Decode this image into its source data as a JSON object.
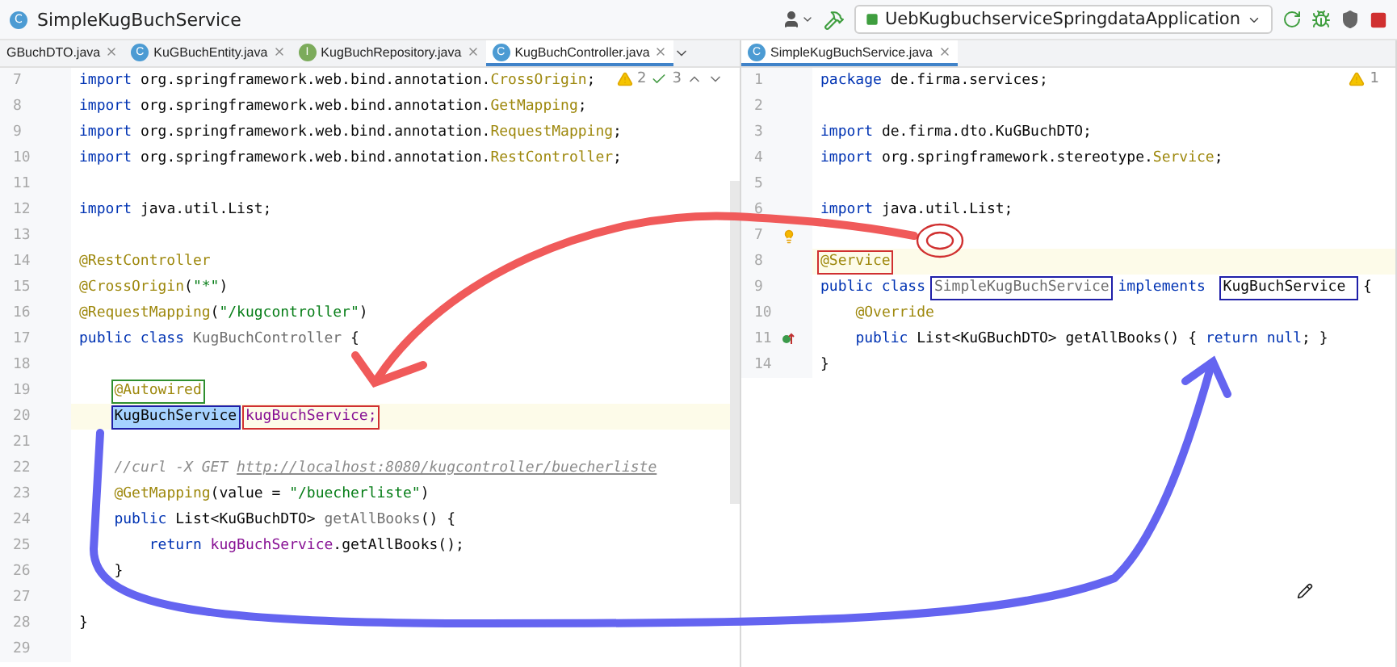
{
  "title_bar": {
    "badge": "C",
    "title": "SimpleKugBuchService",
    "run_config": "UebKugbuchserviceSpringdataApplication"
  },
  "panes": [
    {
      "tabs": [
        {
          "label": "GBuchDTO.java",
          "selected": false
        },
        {
          "label": "KuGBuchEntity.java",
          "badge": "C",
          "kind": "class",
          "selected": false
        },
        {
          "label": "KugBuchRepository.java",
          "badge": "I",
          "kind": "interface",
          "selected": false
        },
        {
          "label": "KugBuchController.java",
          "badge": "C",
          "kind": "class",
          "selected": true
        }
      ],
      "inspection": [
        {
          "kind": "warning",
          "count": "2"
        },
        {
          "kind": "check",
          "count": "3"
        }
      ],
      "lines": [
        {
          "number": "7",
          "current": false,
          "tokens": [
            {
              "kind": "kw",
              "text": "import "
            },
            {
              "kind": "plain",
              "text": "org.springframework.web.bind.annotation."
            },
            {
              "kind": "ann",
              "text": "CrossOrigin"
            },
            {
              "kind": "plain",
              "text": ";"
            }
          ]
        },
        {
          "number": "8",
          "current": false,
          "tokens": [
            {
              "kind": "kw",
              "text": "import "
            },
            {
              "kind": "plain",
              "text": "org.springframework.web.bind.annotation."
            },
            {
              "kind": "ann",
              "text": "GetMapping"
            },
            {
              "kind": "plain",
              "text": ";"
            }
          ]
        },
        {
          "number": "9",
          "current": false,
          "tokens": [
            {
              "kind": "kw",
              "text": "import "
            },
            {
              "kind": "plain",
              "text": "org.springframework.web.bind.annotation."
            },
            {
              "kind": "ann",
              "text": "RequestMapping"
            },
            {
              "kind": "plain",
              "text": ";"
            }
          ]
        },
        {
          "number": "10",
          "current": false,
          "tokens": [
            {
              "kind": "kw",
              "text": "import "
            },
            {
              "kind": "plain",
              "text": "org.springframework.web.bind.annotation."
            },
            {
              "kind": "ann",
              "text": "RestController"
            },
            {
              "kind": "plain",
              "text": ";"
            }
          ]
        },
        {
          "number": "11",
          "current": false
        },
        {
          "number": "12",
          "current": false,
          "tokens": [
            {
              "kind": "kw",
              "text": "import "
            },
            {
              "kind": "plain",
              "text": "java.util.List;"
            }
          ]
        },
        {
          "number": "13",
          "current": false
        },
        {
          "number": "14",
          "current": false,
          "tokens": [
            {
              "kind": "ann",
              "text": "@RestController"
            }
          ]
        },
        {
          "number": "15",
          "current": false,
          "tokens": [
            {
              "kind": "ann",
              "text": "@CrossOrigin"
            },
            {
              "kind": "plain",
              "text": "("
            },
            {
              "kind": "str",
              "text": "\"*\""
            },
            {
              "kind": "plain",
              "text": ")"
            }
          ]
        },
        {
          "number": "16",
          "current": false,
          "tokens": [
            {
              "kind": "ann",
              "text": "@RequestMapping"
            },
            {
              "kind": "plain",
              "text": "("
            },
            {
              "kind": "str",
              "text": "\"/kugcontroller\""
            },
            {
              "kind": "plain",
              "text": ")"
            }
          ]
        },
        {
          "number": "17",
          "current": false,
          "tokens": [
            {
              "kind": "kw",
              "text": "public class "
            },
            {
              "kind": "dim",
              "text": "KugBuchController"
            },
            {
              "kind": "plain",
              "text": " {"
            }
          ]
        },
        {
          "number": "18",
          "current": false
        },
        {
          "number": "19",
          "current": false,
          "tokens": [
            {
              "kind": "ann",
              "text": "    @Autowired",
              "color": "#2f8f2f"
            }
          ]
        },
        {
          "number": "20",
          "current": true,
          "tokens": [
            {
              "kind": "sel",
              "text": "    KugBuchService",
              "color": "#1f1fa8"
            },
            {
              "kind": "field",
              "text": " kugBuchService;",
              "color": "#d03030"
            }
          ]
        },
        {
          "number": "21",
          "current": false
        },
        {
          "number": "22",
          "current": false,
          "tokens": [
            {
              "kind": "cmt",
              "text": "    //curl -X GET "
            },
            {
              "kind": "link",
              "text": "http://localhost:8080/kugcontroller/buecherliste"
            }
          ]
        },
        {
          "number": "23",
          "current": false,
          "tokens": [
            {
              "kind": "ann",
              "text": "    @GetMapping"
            },
            {
              "kind": "plain",
              "text": "(value = "
            },
            {
              "kind": "str",
              "text": "\"/buecherliste\""
            },
            {
              "kind": "plain",
              "text": ")"
            }
          ]
        },
        {
          "number": "24",
          "current": false,
          "tokens": [
            {
              "kind": "kw",
              "text": "    public "
            },
            {
              "kind": "plain",
              "text": "List<KuGBuchDTO> "
            },
            {
              "kind": "dim",
              "text": "getAllBooks"
            },
            {
              "kind": "plain",
              "text": "() {"
            }
          ]
        },
        {
          "number": "25",
          "current": false,
          "tokens": [
            {
              "kind": "kw",
              "text": "        return "
            },
            {
              "kind": "field",
              "text": "kugBuchService"
            },
            {
              "kind": "plain",
              "text": ".getAllBooks();"
            }
          ]
        },
        {
          "number": "26",
          "current": false,
          "tokens": [
            {
              "kind": "plain",
              "text": "    }"
            }
          ]
        },
        {
          "number": "27",
          "current": false
        },
        {
          "number": "28",
          "current": false,
          "tokens": [
            {
              "kind": "plain",
              "text": "}"
            }
          ]
        },
        {
          "number": "29",
          "current": false
        }
      ]
    },
    {
      "tabs": [
        {
          "label": "SimpleKugBuchService.java",
          "badge": "C",
          "kind": "class",
          "selected": true
        }
      ],
      "inspection": [
        {
          "kind": "warning",
          "count": "1"
        }
      ],
      "lines": [
        {
          "number": "1",
          "current": false,
          "tokens": [
            {
              "kind": "kw",
              "text": "package "
            },
            {
              "kind": "plain",
              "text": "de.firma.services;"
            }
          ]
        },
        {
          "number": "2",
          "current": false
        },
        {
          "number": "3",
          "current": false,
          "tokens": [
            {
              "kind": "kw",
              "text": "import "
            },
            {
              "kind": "plain",
              "text": "de.firma.dto.KuGBuchDTO;"
            }
          ]
        },
        {
          "number": "4",
          "current": false,
          "tokens": [
            {
              "kind": "kw",
              "text": "import "
            },
            {
              "kind": "plain",
              "text": "org.springframework.stereotype."
            },
            {
              "kind": "ann",
              "text": "Service"
            },
            {
              "kind": "plain",
              "text": ";"
            }
          ]
        },
        {
          "number": "5",
          "current": false
        },
        {
          "number": "6",
          "current": false,
          "tokens": [
            {
              "kind": "kw",
              "text": "import "
            },
            {
              "kind": "plain",
              "text": "java.util.List;"
            }
          ]
        },
        {
          "number": "7",
          "current": false,
          "marker": {
            "kind": "bulb"
          }
        },
        {
          "number": "8",
          "current": true,
          "tokens": [
            {
              "kind": "ann",
              "text": "@Service",
              "color": "#d03030"
            }
          ]
        },
        {
          "number": "9",
          "current": false,
          "tokens": [
            {
              "kind": "kw",
              "text": "public class "
            },
            {
              "kind": "dim",
              "text": "SimpleKugBuchService",
              "color": "#1f1fa8"
            },
            {
              "kind": "kw",
              "text": " implements "
            },
            {
              "kind": "plain",
              "text": " KugBuchService ",
              "color": "#1f1fa8"
            },
            {
              "kind": "plain",
              "text": " {"
            }
          ]
        },
        {
          "number": "10",
          "current": false,
          "tokens": [
            {
              "kind": "ann",
              "text": "    @Override"
            }
          ]
        },
        {
          "number": "11",
          "current": false,
          "marker": {
            "kind": "implements"
          },
          "tokens": [
            {
              "kind": "kw",
              "text": "    public "
            },
            {
              "kind": "plain",
              "text": "List<KuGBuchDTO> getAllBooks() { "
            },
            {
              "kind": "kw",
              "text": "return null"
            },
            {
              "kind": "plain",
              "text": "; }"
            }
          ]
        },
        {
          "number": "14",
          "current": false,
          "tokens": [
            {
              "kind": "plain",
              "text": "}"
            }
          ]
        }
      ]
    }
  ]
}
